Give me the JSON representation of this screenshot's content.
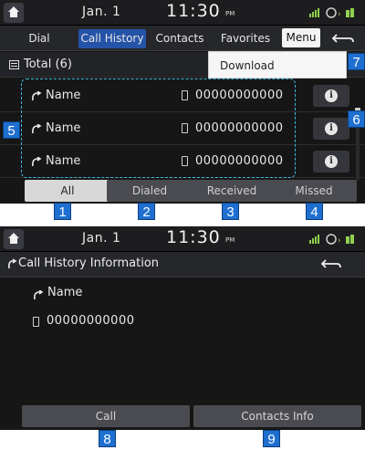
{
  "screen1": {
    "status": {
      "date": "Jan.  1",
      "time": "11:30",
      "ampm": "PM"
    },
    "tabs": [
      {
        "label": "Dial"
      },
      {
        "label": "Call History",
        "active": true
      },
      {
        "label": "Contacts"
      },
      {
        "label": "Favorites"
      }
    ],
    "menu_label": "Menu",
    "total_label": "Total (6)",
    "dropdown_item": "Download",
    "rows": [
      {
        "name": "Name",
        "number": "00000000000"
      },
      {
        "name": "Name",
        "number": "00000000000"
      },
      {
        "name": "Name",
        "number": "00000000000"
      }
    ],
    "filters": [
      {
        "label": "All",
        "active": true
      },
      {
        "label": "Dialed"
      },
      {
        "label": "Received"
      },
      {
        "label": "Missed"
      }
    ]
  },
  "screen2": {
    "status": {
      "date": "Jan.  1",
      "time": "11:30",
      "ampm": "PM"
    },
    "title": "Call History Information",
    "name": "Name",
    "number": "00000000000",
    "buttons": [
      {
        "label": "Call"
      },
      {
        "label": "Contacts Info"
      }
    ]
  },
  "callouts": [
    "1",
    "2",
    "3",
    "4",
    "5",
    "6",
    "7",
    "8",
    "9"
  ],
  "colors": {
    "accent": "#2553a8",
    "callout": "#1e6fd0",
    "highlight_border": "#3fb7e0",
    "background": "#161616"
  }
}
